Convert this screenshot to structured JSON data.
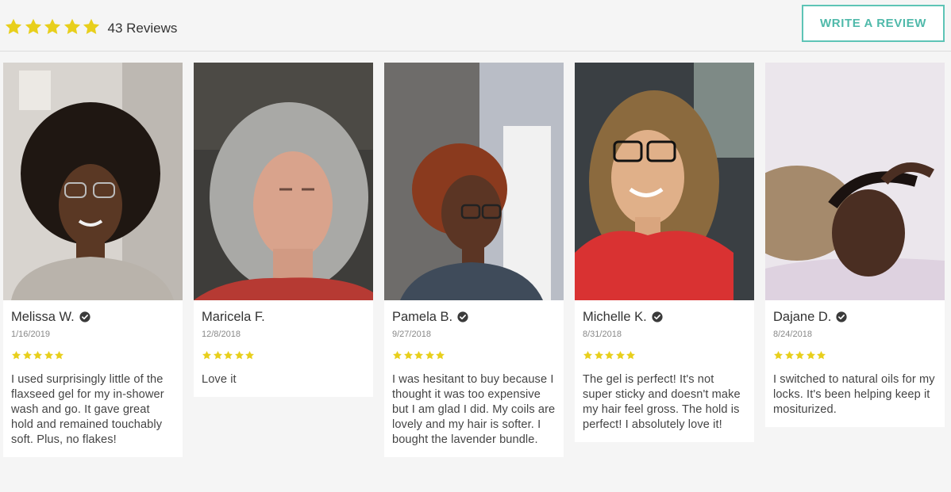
{
  "summary": {
    "rating": 5,
    "count_label": "43 Reviews"
  },
  "write_review_label": "WRITE A REVIEW",
  "colors": {
    "star": "#e8cf1c",
    "accent": "#5ec4b6"
  },
  "reviews": [
    {
      "name": "Melissa W.",
      "verified": true,
      "date": "1/16/2019",
      "rating": 5,
      "text": "I used surprisingly little of the flaxseed gel for my in-shower wash and go. It gave great hold and remained touchably soft. Plus, no flakes!"
    },
    {
      "name": "Maricela F.",
      "verified": false,
      "date": "12/8/2018",
      "rating": 5,
      "text": "Love it"
    },
    {
      "name": "Pamela B.",
      "verified": true,
      "date": "9/27/2018",
      "rating": 5,
      "text": "I was hesitant to buy because I thought it was too expensive but I am glad I did. My coils are lovely and my hair is softer. I bought the lavender bundle."
    },
    {
      "name": "Michelle K.",
      "verified": true,
      "date": "8/31/2018",
      "rating": 5,
      "text": "The gel is perfect! It's not super sticky and doesn't make my hair feel gross. The hold is perfect! I absolutely love it!"
    },
    {
      "name": "Dajane D.",
      "verified": true,
      "date": "8/24/2018",
      "rating": 5,
      "text": "I switched to natural oils for my locks. It's been helping keep it mositurized."
    }
  ]
}
